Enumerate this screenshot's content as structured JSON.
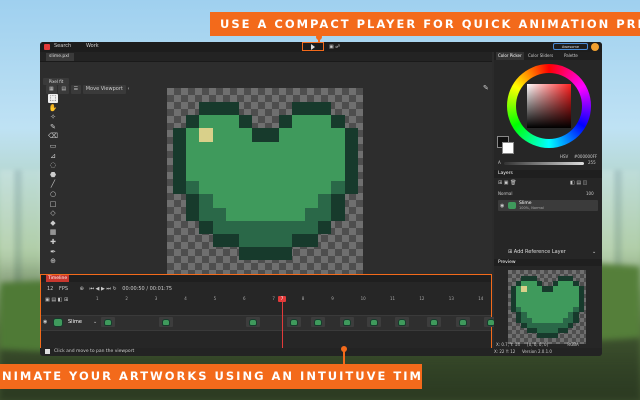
{
  "banners": {
    "top": "USE A COMPACT PLAYER FOR QUICK ANIMATION PREVIEW",
    "bottom": "NIMATE YOUR ARTWORKS USING AN INTUITUVE TIMELINE"
  },
  "app": {
    "menu": [
      "Search",
      "Work"
    ],
    "support_label": "Awesome Supporter",
    "file_tab": "slime.pxl"
  },
  "toolbar": {
    "pixelfit_label": "Pixel fit",
    "move_viewport": "Move Viewport",
    "tools": [
      "select-icon",
      "hand-icon",
      "magic-wand-icon",
      "pencil-icon",
      "eraser-icon",
      "rect-select-icon",
      "eyedropper-icon",
      "lasso-icon",
      "bucket-icon",
      "line-icon",
      "circle-icon",
      "rectangle-icon",
      "shape-icon",
      "fill-icon",
      "dither-icon",
      "picker-icon",
      "brush-icon",
      "zoom-icon"
    ]
  },
  "timeline": {
    "title": "Timeline",
    "fps_value": "12",
    "fps_label": "FPS",
    "time": "00:00:50 / 00:01:75",
    "layer_name": "Slime",
    "ruler": [
      "1",
      "2",
      "3",
      "4",
      "5",
      "6",
      "7",
      "8",
      "9",
      "10",
      "11",
      "12",
      "13",
      "14"
    ],
    "current_frame": "7"
  },
  "status": {
    "hint": "Click and move to pan the viewport",
    "coords": "X: 22 Y: 12",
    "version": "Version 2.0.1.0"
  },
  "right_panel": {
    "tabs": [
      "Color Picker",
      "Color Sliders",
      "Palette"
    ],
    "hex_mode": "HSV",
    "hex_value": "#000000FF",
    "alpha_label": "A",
    "alpha_value": "255",
    "layers_title": "Layers",
    "blend_mode": "Normal",
    "opacity": "100",
    "layer_name": "Slime",
    "layer_sub": "100%, Normal",
    "add_reference": "Add Reference Layer",
    "preview_title": "Preview",
    "preview_coords": "X: 0.7, Y: 14",
    "preview_extra": "[0, 0, 0, 0]",
    "preview_mode": "RGBA"
  },
  "colors": {
    "accent": "#f36a1b",
    "heart_dark": "#173a2c",
    "heart_mid": "#2a6848",
    "heart_light": "#3f9a5c",
    "heart_highlight": "#d9d08a"
  }
}
